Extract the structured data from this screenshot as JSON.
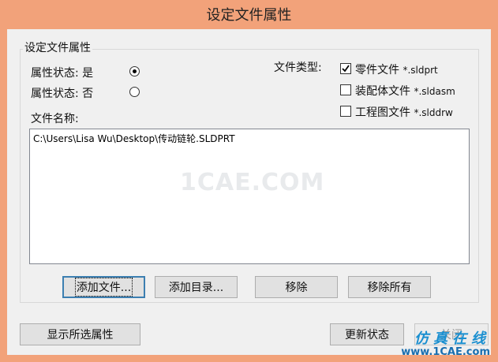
{
  "window": {
    "title": "设定文件属性"
  },
  "group": {
    "title": "设定文件属性"
  },
  "attr_state": {
    "yes_label": "属性状态: 是",
    "no_label": "属性状态: 否",
    "selected": "yes"
  },
  "file_type": {
    "label": "文件类型:",
    "options": [
      {
        "label": "零件文件",
        "ext": "*.sldprt",
        "checked": true
      },
      {
        "label": "装配体文件",
        "ext": "*.sldasm",
        "checked": false
      },
      {
        "label": "工程图文件",
        "ext": "*.slddrw",
        "checked": false
      }
    ]
  },
  "file_list": {
    "label": "文件名称:",
    "items": [
      "C:\\Users\\Lisa Wu\\Desktop\\传动链轮.SLDPRT"
    ],
    "watermark": "1CAE.COM"
  },
  "buttons": {
    "add_file": "添加文件...",
    "add_dir": "添加目录...",
    "remove": "移除",
    "remove_all": "移除所有",
    "show_selected": "显示所选属性",
    "update_state": "更新状态",
    "close": "关闭"
  },
  "logo": {
    "line1": "仿真在线",
    "line2": "www.1CAE.com"
  },
  "colors": {
    "frame": "#f2a27a",
    "client": "#f0f0f0",
    "focus": "#3c7fb1"
  }
}
